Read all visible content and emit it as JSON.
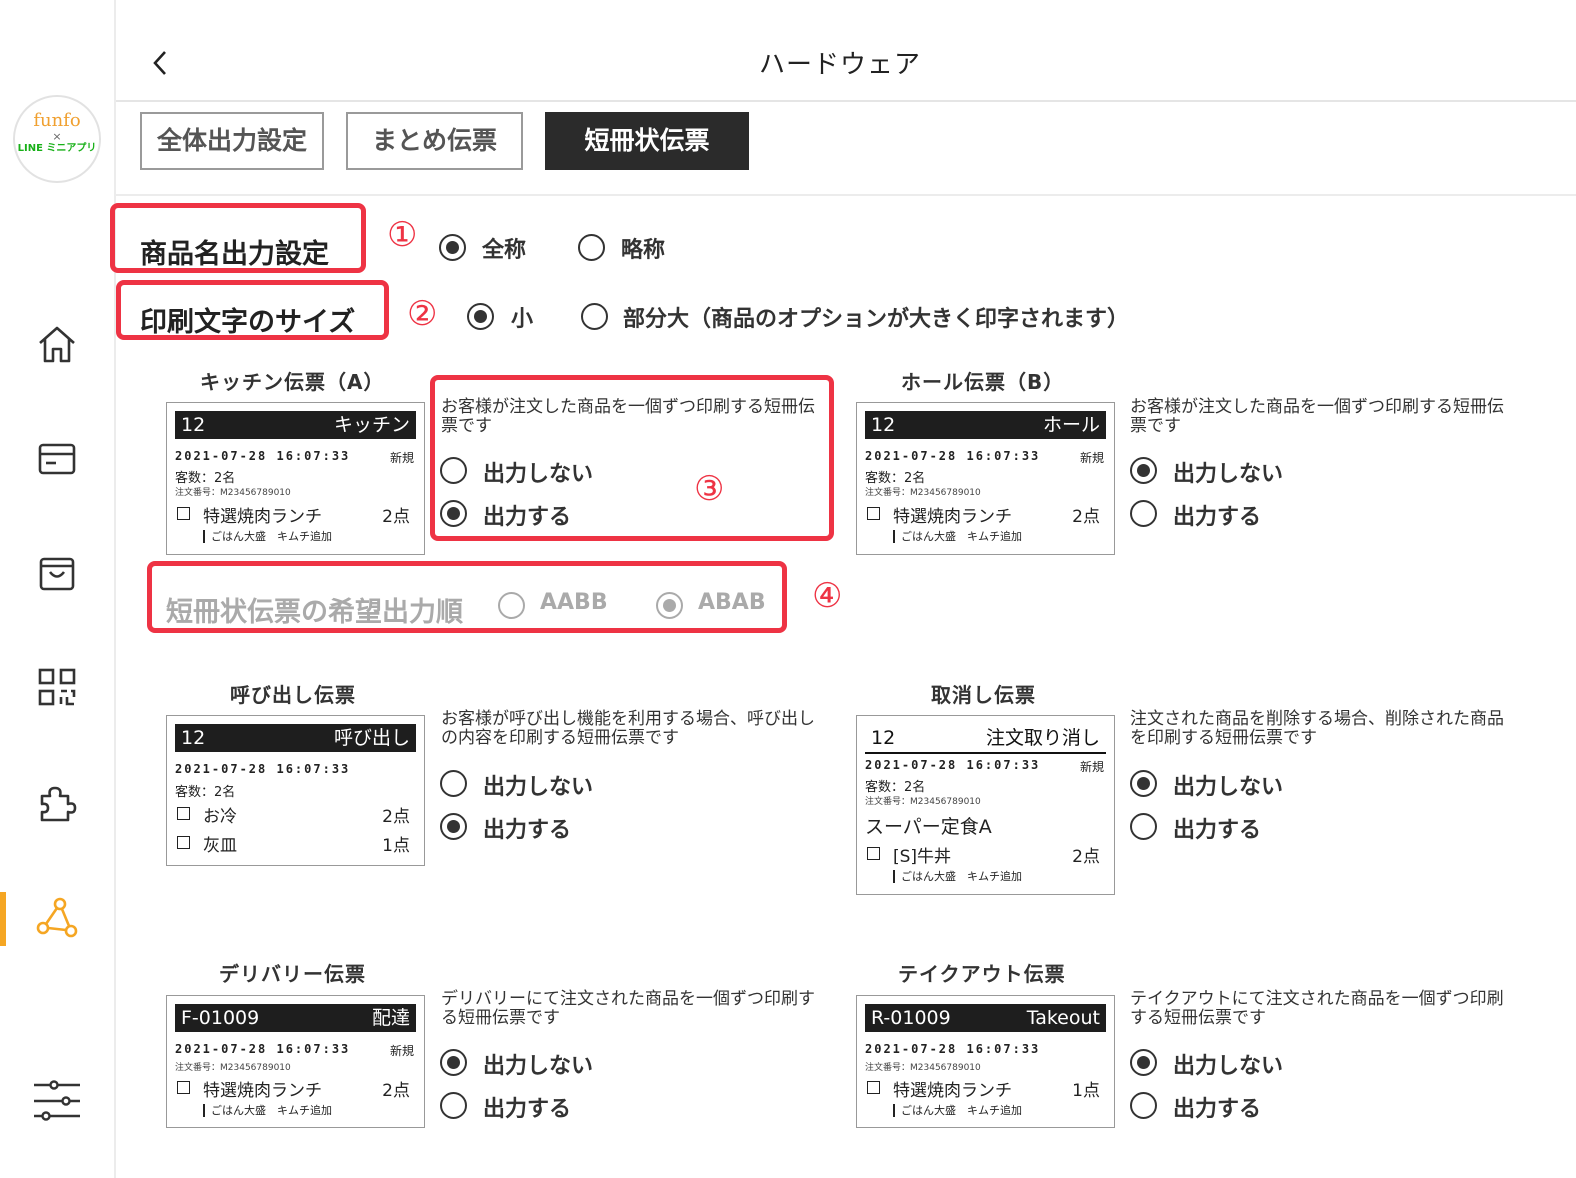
{
  "app": {
    "logo": {
      "line1": "funfo",
      "line2": "×",
      "line3": "LINE ミニアプリ"
    },
    "title": "ハードウェア"
  },
  "tabs": [
    {
      "label": "全体出力設定",
      "active": false
    },
    {
      "label": "まとめ伝票",
      "active": false
    },
    {
      "label": "短冊状伝票",
      "active": true
    }
  ],
  "settings": {
    "product_name": {
      "number": "①",
      "label": "商品名出力設定",
      "options": [
        "全称",
        "略称"
      ],
      "selected": "全称"
    },
    "print_size": {
      "number": "②",
      "label": "印刷文字のサイズ",
      "options": [
        "小",
        "部分大（商品のオプションが大きく印字されます）"
      ],
      "selected": "小"
    },
    "order": {
      "number": "④",
      "label": "短冊状伝票の希望出力順",
      "options": [
        "AABB",
        "ABAB"
      ],
      "selected": "ABAB",
      "disabled": true
    }
  },
  "annotation3": "③",
  "output_options": [
    "出力しない",
    "出力する"
  ],
  "slips": {
    "kitchen": {
      "title": "キッチン伝票（A）",
      "desc": "お客様が注文した商品を一個ずつ印刷する短冊伝票です",
      "selected": "出力する",
      "ticket": {
        "no": "12",
        "type": "キッチン",
        "date": "2021-07-28 16:07:33",
        "status": "新規",
        "guests": "客数：2名",
        "order_no": "注文番号：M23456789010",
        "item": "特選焼肉ランチ",
        "qty": "2点",
        "option": "ごはん大盛　キムチ追加"
      }
    },
    "hall": {
      "title": "ホール伝票（B）",
      "desc": "お客様が注文した商品を一個ずつ印刷する短冊伝票です",
      "selected": "出力しない",
      "ticket": {
        "no": "12",
        "type": "ホール",
        "date": "2021-07-28 16:07:33",
        "status": "新規",
        "guests": "客数：2名",
        "order_no": "注文番号：M23456789010",
        "item": "特選焼肉ランチ",
        "qty": "2点",
        "option": "ごはん大盛　キムチ追加"
      }
    },
    "call": {
      "title": "呼び出し伝票",
      "desc": "お客様が呼び出し機能を利用する場合、呼び出しの内容を印刷する短冊伝票です",
      "selected": "出力する",
      "ticket": {
        "no": "12",
        "type": "呼び出し",
        "date": "2021-07-28 16:07:33",
        "guests": "客数：2名",
        "item1": "お冷",
        "qty1": "2点",
        "item2": "灰皿",
        "qty2": "1点"
      }
    },
    "cancel": {
      "title": "取消し伝票",
      "desc": "注文された商品を削除する場合、削除された商品を印刷する短冊伝票です",
      "selected": "出力しない",
      "ticket": {
        "no": "12",
        "type": "注文取り消し",
        "date": "2021-07-28 16:07:33",
        "status": "新規",
        "guests": "客数：2名",
        "order_no": "注文番号：M23456789010",
        "set": "スーパー定食A",
        "item": "[S]牛丼",
        "qty": "2点",
        "option": "ごはん大盛　キムチ追加"
      }
    },
    "delivery": {
      "title": "デリバリー伝票",
      "desc": "デリバリーにて注文された商品を一個ずつ印刷する短冊伝票です",
      "selected": "出力しない",
      "ticket": {
        "no": "F-01009",
        "type": "配達",
        "date": "2021-07-28 16:07:33",
        "status": "新規",
        "order_no": "注文番号：M23456789010",
        "item": "特選焼肉ランチ",
        "qty": "2点",
        "option": "ごはん大盛　キムチ追加"
      }
    },
    "takeout": {
      "title": "テイクアウト伝票",
      "desc": "テイクアウトにて注文された商品を一個ずつ印刷する短冊伝票です",
      "selected": "出力しない",
      "ticket": {
        "no": "R-01009",
        "type": "Takeout",
        "date": "2021-07-28 16:07:33",
        "order_no": "注文番号：M23456789010",
        "item": "特選焼肉ランチ",
        "qty": "1点",
        "option": "ごはん大盛　キムチ追加"
      }
    }
  },
  "nav": [
    {
      "icon": "home-icon",
      "active": false
    },
    {
      "icon": "card-icon",
      "active": false
    },
    {
      "icon": "bag-icon",
      "active": false
    },
    {
      "icon": "qr-code-icon",
      "active": false
    },
    {
      "icon": "puzzle-icon",
      "active": false
    },
    {
      "icon": "network-icon",
      "active": true
    },
    {
      "icon": "sliders-icon",
      "active": false
    }
  ],
  "colors": {
    "accent": "#f5a623",
    "annotation": "#ee3344",
    "tab_active_bg": "#2b2b2b"
  }
}
